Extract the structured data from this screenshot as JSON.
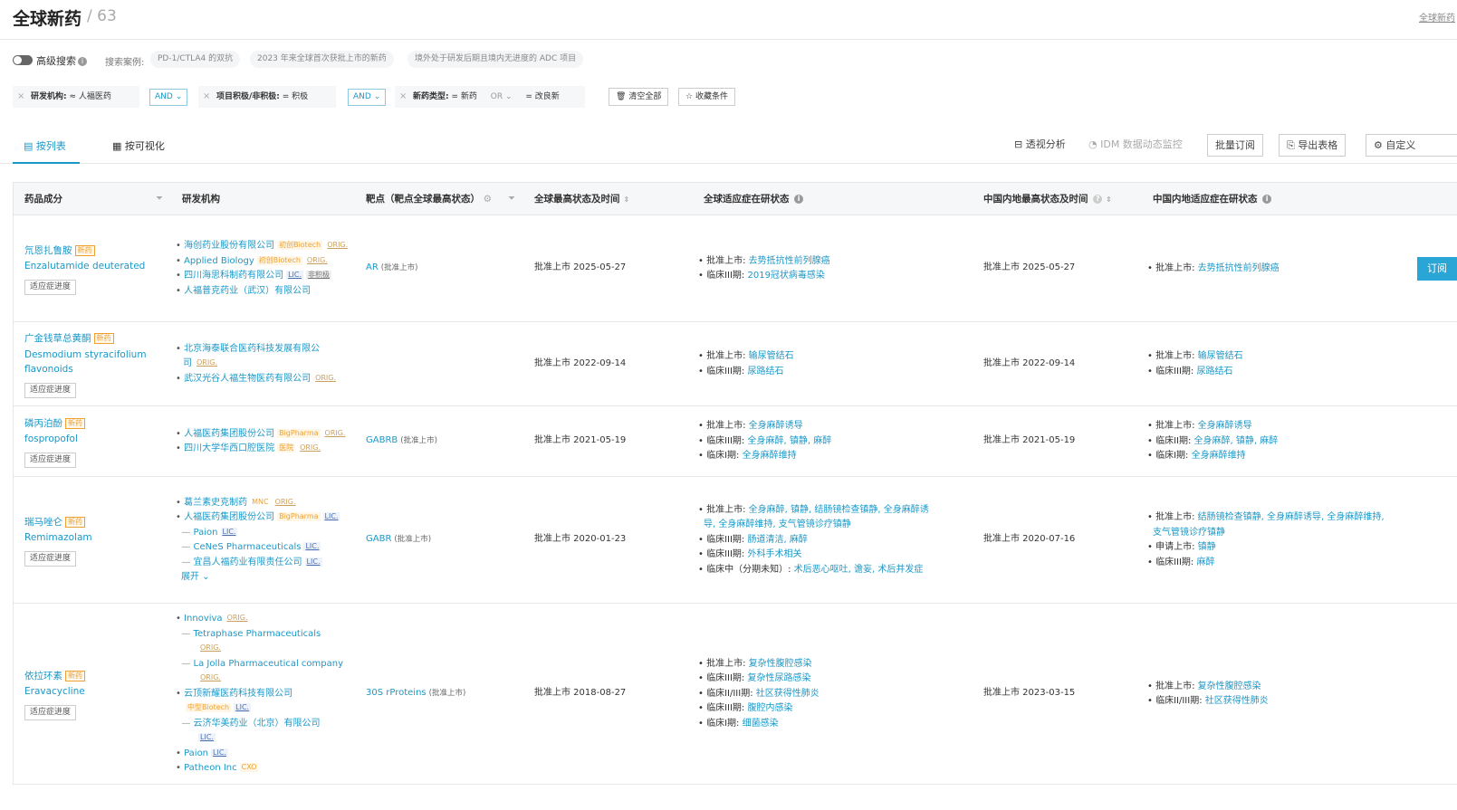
{
  "header": {
    "title": "全球新药",
    "count": "/ 63",
    "right_link": "全球新药"
  },
  "search": {
    "advanced_label": "高级搜索",
    "examples_label": "搜索案例:",
    "examples": [
      "PD-1/CTLA4 的双抗",
      "2023 年来全球首次获批上市的新药",
      "境外处于研发后期且境内无进度的 ADC 项目"
    ]
  },
  "filters": {
    "f1_label": "研发机构:",
    "f1_value": "≈ 人福医药",
    "and1": "AND",
    "f2_label": "项目积极/非积极:",
    "f2_value": "= 积极",
    "and2": "AND",
    "f3_label": "新药类型:",
    "f3_value": "= 新药",
    "f3_or": "OR",
    "f3_value2": "= 改良新",
    "clear_all": "清空全部",
    "save": "收藏条件"
  },
  "tabs": {
    "list": "按列表",
    "visual": "按可视化",
    "pivot": "透视分析",
    "idm": "IDM 数据动态监控",
    "batch": "批量订阅",
    "export": "导出表格",
    "custom": "自定义"
  },
  "columns": {
    "drug": "药品成分",
    "org": "研发机构",
    "target": "靶点（靶点全球最高状态）",
    "global_status": "全球最高状态及时间",
    "global_ind": "全球适应症在研状态",
    "cn_status": "中国内地最高状态及时间",
    "cn_ind": "中国内地适应症在研状态"
  },
  "common": {
    "new_tag": "新药",
    "progress_btn": "适应症进度",
    "subscribe": "订阅",
    "expand": "展开"
  },
  "rows": [
    {
      "cn": "氘恩扎鲁胺",
      "en": [
        "Enzalutamide deuterated"
      ],
      "orgs": [
        {
          "name": "海创药业股份有限公司",
          "tags": [
            {
              "t": "初创Biotech",
              "k": "bio"
            },
            {
              "t": "ORIG.",
              "k": "orig"
            }
          ]
        },
        {
          "name": "Applied Biology",
          "tags": [
            {
              "t": "初创Biotech",
              "k": "bio"
            },
            {
              "t": "ORIG.",
              "k": "orig"
            }
          ]
        },
        {
          "name": "四川海思科制药有限公司",
          "tags": [
            {
              "t": "LIC.",
              "k": "lic"
            },
            {
              "t": "非积极",
              "k": "gray"
            }
          ]
        },
        {
          "name": "人福普克药业（武汉）有限公司",
          "tags": []
        }
      ],
      "target": "AR",
      "target_status": "(批准上市)",
      "global_status": "批准上市 2025-05-27",
      "global_ind": [
        {
          "s": "批准上市:",
          "v": "去势抵抗性前列腺癌"
        },
        {
          "s": "临床III期:",
          "v": "2019冠状病毒感染"
        }
      ],
      "cn_status": "批准上市 2025-05-27",
      "cn_ind": [
        {
          "s": "批准上市:",
          "v": "去势抵抗性前列腺癌"
        }
      ]
    },
    {
      "cn": "广金钱草总黄酮",
      "en": [
        "Desmodium styracifolium",
        "flavonoids"
      ],
      "orgs": [
        {
          "name": "北京海泰联合医药科技发展有限公",
          "cont": "司",
          "tags": [
            {
              "t": "ORIG.",
              "k": "orig"
            }
          ]
        },
        {
          "name": "武汉光谷人福生物医药有限公司",
          "tags": [
            {
              "t": "ORIG.",
              "k": "orig"
            }
          ]
        }
      ],
      "target": "",
      "target_status": "",
      "global_status": "批准上市 2022-09-14",
      "global_ind": [
        {
          "s": "批准上市:",
          "v": "输尿管结石"
        },
        {
          "s": "临床III期:",
          "v": "尿路结石"
        }
      ],
      "cn_status": "批准上市 2022-09-14",
      "cn_ind": [
        {
          "s": "批准上市:",
          "v": "输尿管结石"
        },
        {
          "s": "临床III期:",
          "v": "尿路结石"
        }
      ]
    },
    {
      "cn": "磷丙泊酚",
      "en": [
        "fospropofol"
      ],
      "orgs": [
        {
          "name": "人福医药集团股份公司",
          "tags": [
            {
              "t": "BigPharma",
              "k": "bio"
            },
            {
              "t": "ORIG.",
              "k": "orig"
            }
          ]
        },
        {
          "name": "四川大学华西口腔医院",
          "tags": [
            {
              "t": "医院",
              "k": "hosp"
            },
            {
              "t": "ORIG.",
              "k": "orig"
            }
          ]
        }
      ],
      "target": "GABRB",
      "target_status": "(批准上市)",
      "global_status": "批准上市 2021-05-19",
      "global_ind": [
        {
          "s": "批准上市:",
          "v": "全身麻醉诱导"
        },
        {
          "s": "临床III期:",
          "v": "全身麻醉, 镇静, 麻醉"
        },
        {
          "s": "临床I期:",
          "v": "全身麻醉维持"
        }
      ],
      "cn_status": "批准上市 2021-05-19",
      "cn_ind": [
        {
          "s": "批准上市:",
          "v": "全身麻醉诱导"
        },
        {
          "s": "临床II期:",
          "v": "全身麻醉, 镇静, 麻醉"
        },
        {
          "s": "临床I期:",
          "v": "全身麻醉维持"
        }
      ]
    },
    {
      "cn": "瑞马唑仑",
      "en": [
        "Remimazolam"
      ],
      "orgs": [
        {
          "name": "葛兰素史克制药",
          "tags": [
            {
              "t": "MNC",
              "k": "mnc"
            },
            {
              "t": "ORIG.",
              "k": "orig"
            }
          ]
        },
        {
          "name": "人福医药集团股份公司",
          "tags": [
            {
              "t": "BigPharma",
              "k": "bio"
            },
            {
              "t": "LIC.",
              "k": "lic"
            }
          ]
        },
        {
          "name": "Paion",
          "sub": true,
          "tags": [
            {
              "t": "LIC.",
              "k": "lic"
            }
          ]
        },
        {
          "name": "CeNeS Pharmaceuticals",
          "sub": true,
          "tags": [
            {
              "t": "LIC.",
              "k": "lic"
            }
          ]
        },
        {
          "name": "宜昌人福药业有限责任公司",
          "sub": true,
          "tags": [
            {
              "t": "LIC.",
              "k": "lic"
            }
          ]
        }
      ],
      "expand": true,
      "target": "GABR",
      "target_status": "(批准上市)",
      "global_status": "批准上市 2020-01-23",
      "global_ind": [
        {
          "s": "批准上市:",
          "v": "全身麻醉, 镇静, 结肠镜检查镇静, 全身麻醉诱",
          "cont": "导, 全身麻醉维持, 支气管镜诊疗镇静"
        },
        {
          "s": "临床III期:",
          "v": "肠道清洁, 麻醉"
        },
        {
          "s": "临床III期:",
          "v": "外科手术相关"
        },
        {
          "s": "临床中（分期未知）:",
          "v": "术后恶心呕吐, 谵妄, 术后并发症"
        }
      ],
      "cn_status": "批准上市 2020-07-16",
      "cn_ind": [
        {
          "s": "批准上市:",
          "v": "结肠镜检查镇静, 全身麻醉诱导, 全身麻醉维持,",
          "cont": "支气管镜诊疗镇静"
        },
        {
          "s": "申请上市:",
          "v": "镇静"
        },
        {
          "s": "临床III期:",
          "v": "麻醉"
        }
      ]
    },
    {
      "cn": "依拉环素",
      "en": [
        "Eravacycline"
      ],
      "orgs": [
        {
          "name": "Innoviva",
          "tags": [
            {
              "t": "ORIG.",
              "k": "orig"
            }
          ]
        },
        {
          "name": "Tetraphase Pharmaceuticals",
          "sub": true,
          "tagline": true,
          "tags": [
            {
              "t": "ORIG.",
              "k": "orig"
            }
          ]
        },
        {
          "name": "La Jolla Pharmaceutical company",
          "sub": true,
          "tagline": true,
          "tags": [
            {
              "t": "ORIG.",
              "k": "orig"
            }
          ]
        },
        {
          "name": "云顶新耀医药科技有限公司",
          "tagline": true,
          "tags": [
            {
              "t": "中型Biotech",
              "k": "bio"
            },
            {
              "t": "LIC.",
              "k": "lic"
            }
          ]
        },
        {
          "name": "云济华美药业（北京）有限公司",
          "sub": true,
          "tagline": true,
          "tags": [
            {
              "t": "LIC.",
              "k": "lic"
            }
          ]
        },
        {
          "name": "Paion",
          "tags": [
            {
              "t": "LIC.",
              "k": "lic"
            }
          ]
        },
        {
          "name": "Patheon Inc",
          "tags": [
            {
              "t": "CXO",
              "k": "cxo"
            }
          ]
        }
      ],
      "target": "30S rProteins",
      "target_status": "(批准上市)",
      "global_status": "批准上市 2018-08-27",
      "global_ind": [
        {
          "s": "批准上市:",
          "v": "复杂性腹腔感染"
        },
        {
          "s": "临床III期:",
          "v": "复杂性尿路感染"
        },
        {
          "s": "临床II/III期:",
          "v": "社区获得性肺炎"
        },
        {
          "s": "临床III期:",
          "v": "腹腔内感染"
        },
        {
          "s": "临床I期:",
          "v": "细菌感染"
        }
      ],
      "cn_status": "批准上市 2023-03-15",
      "cn_ind": [
        {
          "s": "批准上市:",
          "v": "复杂性腹腔感染"
        },
        {
          "s": "临床II/III期:",
          "v": "社区获得性肺炎"
        }
      ]
    }
  ]
}
